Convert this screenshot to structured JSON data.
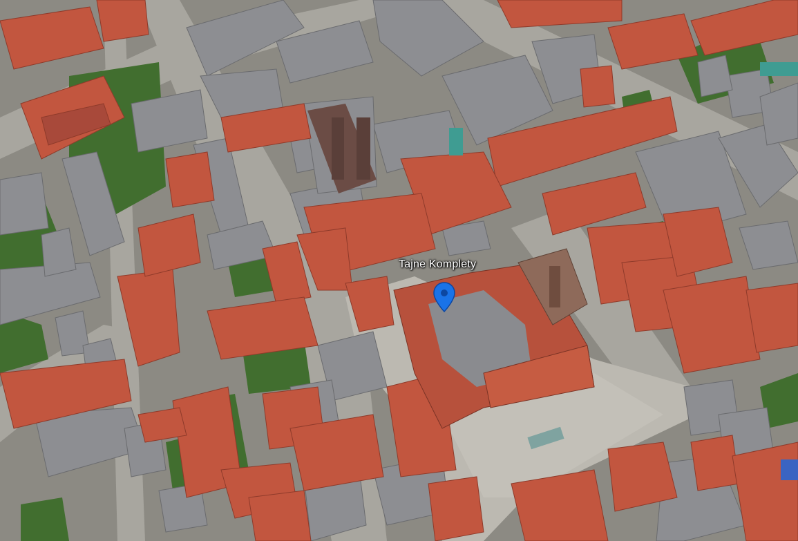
{
  "map": {
    "place_label": "Tajne Komplety",
    "marker_icon": "location-pin-icon",
    "colors": {
      "marker": "#1a73e8",
      "label_text": "#ffffff",
      "roof_red": "#c8553f",
      "roof_grey": "#8e8f93",
      "square": "#b9b6ae",
      "street": "#a7a59e",
      "green": "#3f6f2e"
    }
  }
}
